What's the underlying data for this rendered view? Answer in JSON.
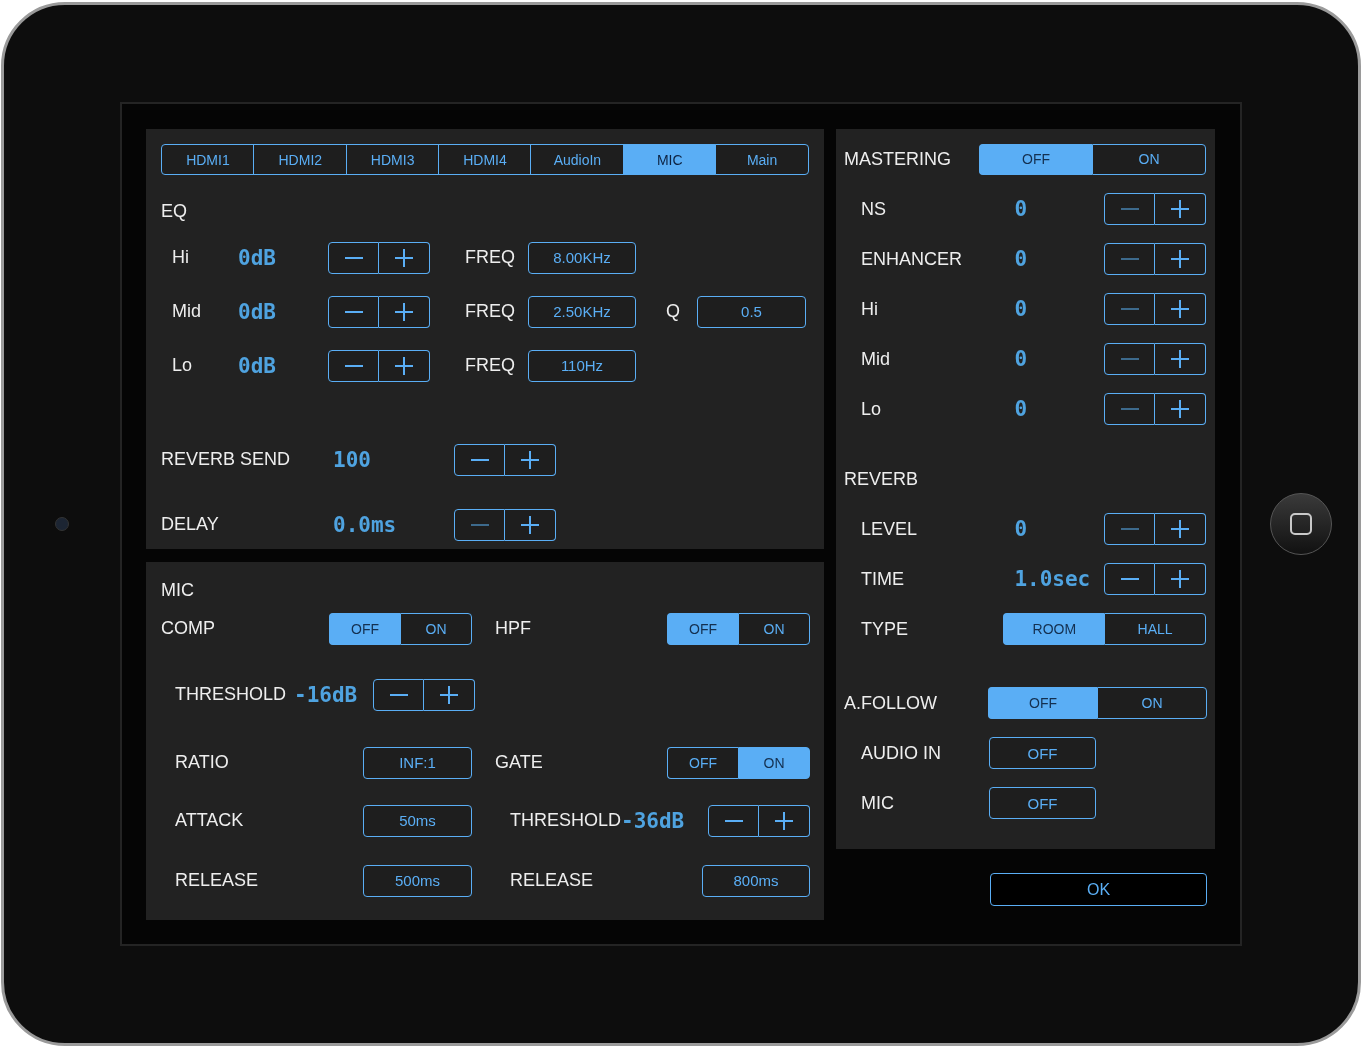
{
  "tabs": [
    {
      "label": "HDMI1",
      "selected": false
    },
    {
      "label": "HDMI2",
      "selected": false
    },
    {
      "label": "HDMI3",
      "selected": false
    },
    {
      "label": "HDMI4",
      "selected": false
    },
    {
      "label": "AudioIn",
      "selected": false
    },
    {
      "label": "MIC",
      "selected": true
    },
    {
      "label": "Main",
      "selected": false
    }
  ],
  "eq": {
    "title": "EQ",
    "bands": [
      {
        "label": "Hi",
        "value": "0dB",
        "minus_disabled": false,
        "freq_label": "FREQ",
        "freq": "8.00KHz"
      },
      {
        "label": "Mid",
        "value": "0dB",
        "minus_disabled": false,
        "freq_label": "FREQ",
        "freq": "2.50KHz",
        "q_label": "Q",
        "q": "0.5"
      },
      {
        "label": "Lo",
        "value": "0dB",
        "minus_disabled": false,
        "freq_label": "FREQ",
        "freq": "110Hz"
      }
    ]
  },
  "sends": [
    {
      "label": "REVERB SEND",
      "value": "100",
      "minus_disabled": false
    },
    {
      "label": "DELAY",
      "value": "0.0ms",
      "minus_disabled": true
    }
  ],
  "mic": {
    "title": "MIC",
    "comp": {
      "label": "COMP",
      "options": [
        {
          "label": "OFF",
          "selected": true
        },
        {
          "label": "ON",
          "selected": false
        }
      ]
    },
    "hpf": {
      "label": "HPF",
      "options": [
        {
          "label": "OFF",
          "selected": true
        },
        {
          "label": "ON",
          "selected": false
        }
      ]
    },
    "comp_threshold": {
      "label": "THRESHOLD",
      "value": "-16dB",
      "minus_disabled": false
    },
    "ratio": {
      "label": "RATIO",
      "value": "INF:1"
    },
    "gate": {
      "label": "GATE",
      "options": [
        {
          "label": "OFF",
          "selected": false
        },
        {
          "label": "ON",
          "selected": true
        }
      ]
    },
    "attack": {
      "label": "ATTACK",
      "value": "50ms"
    },
    "gate_threshold": {
      "label": "THRESHOLD",
      "value": "-36dB",
      "minus_disabled": false
    },
    "comp_release": {
      "label": "RELEASE",
      "value": "500ms"
    },
    "gate_release": {
      "label": "RELEASE",
      "value": "800ms"
    }
  },
  "mastering": {
    "label": "MASTERING",
    "options": [
      {
        "label": "OFF",
        "selected": true
      },
      {
        "label": "ON",
        "selected": false
      }
    ],
    "items": [
      {
        "label": "NS",
        "value": "0",
        "minus_disabled": true
      },
      {
        "label": "ENHANCER",
        "value": "0",
        "minus_disabled": true
      },
      {
        "label": "Hi",
        "value": "0",
        "minus_disabled": true
      },
      {
        "label": "Mid",
        "value": "0",
        "minus_disabled": true
      },
      {
        "label": "Lo",
        "value": "0",
        "minus_disabled": true
      }
    ]
  },
  "reverb": {
    "title": "REVERB",
    "level": {
      "label": "LEVEL",
      "value": "0",
      "minus_disabled": true
    },
    "time": {
      "label": "TIME",
      "value": "1.0sec",
      "minus_disabled": false
    },
    "type": {
      "label": "TYPE",
      "options": [
        {
          "label": "ROOM",
          "selected": true
        },
        {
          "label": "HALL",
          "selected": false
        }
      ]
    }
  },
  "a_follow": {
    "label": "A.FOLLOW",
    "options": [
      {
        "label": "OFF",
        "selected": true
      },
      {
        "label": "ON",
        "selected": false
      }
    ],
    "items": [
      {
        "label": "AUDIO IN",
        "value": "OFF"
      },
      {
        "label": "MIC",
        "value": "OFF"
      }
    ]
  },
  "ok": "OK"
}
